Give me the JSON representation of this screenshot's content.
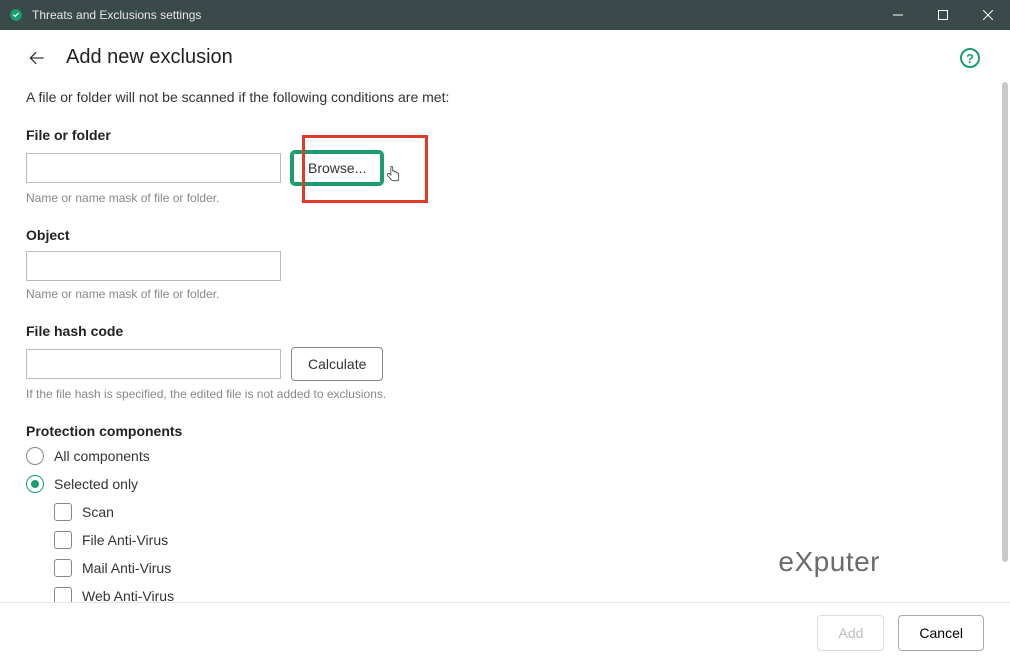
{
  "window": {
    "title": "Threats and Exclusions settings"
  },
  "header": {
    "page_title": "Add new exclusion"
  },
  "intro": "A file or folder will not be scanned if the following conditions are met:",
  "file_or_folder": {
    "label": "File or folder",
    "value": "",
    "browse_label": "Browse...",
    "hint": "Name or name mask of file or folder."
  },
  "object": {
    "label": "Object",
    "value": "",
    "hint": "Name or name mask of file or folder."
  },
  "file_hash": {
    "label": "File hash code",
    "value": "",
    "calculate_label": "Calculate",
    "hint": "If the file hash is specified, the edited file is not added to exclusions."
  },
  "protection": {
    "label": "Protection components",
    "options": {
      "all": "All components",
      "selected": "Selected only"
    },
    "selected_value": "selected",
    "components": [
      {
        "id": "scan",
        "label": "Scan",
        "checked": false
      },
      {
        "id": "file-av",
        "label": "File Anti-Virus",
        "checked": false
      },
      {
        "id": "mail-av",
        "label": "Mail Anti-Virus",
        "checked": false
      },
      {
        "id": "web-av",
        "label": "Web Anti-Virus",
        "checked": false
      }
    ]
  },
  "footer": {
    "add_label": "Add",
    "cancel_label": "Cancel"
  },
  "watermark": "eXputer"
}
